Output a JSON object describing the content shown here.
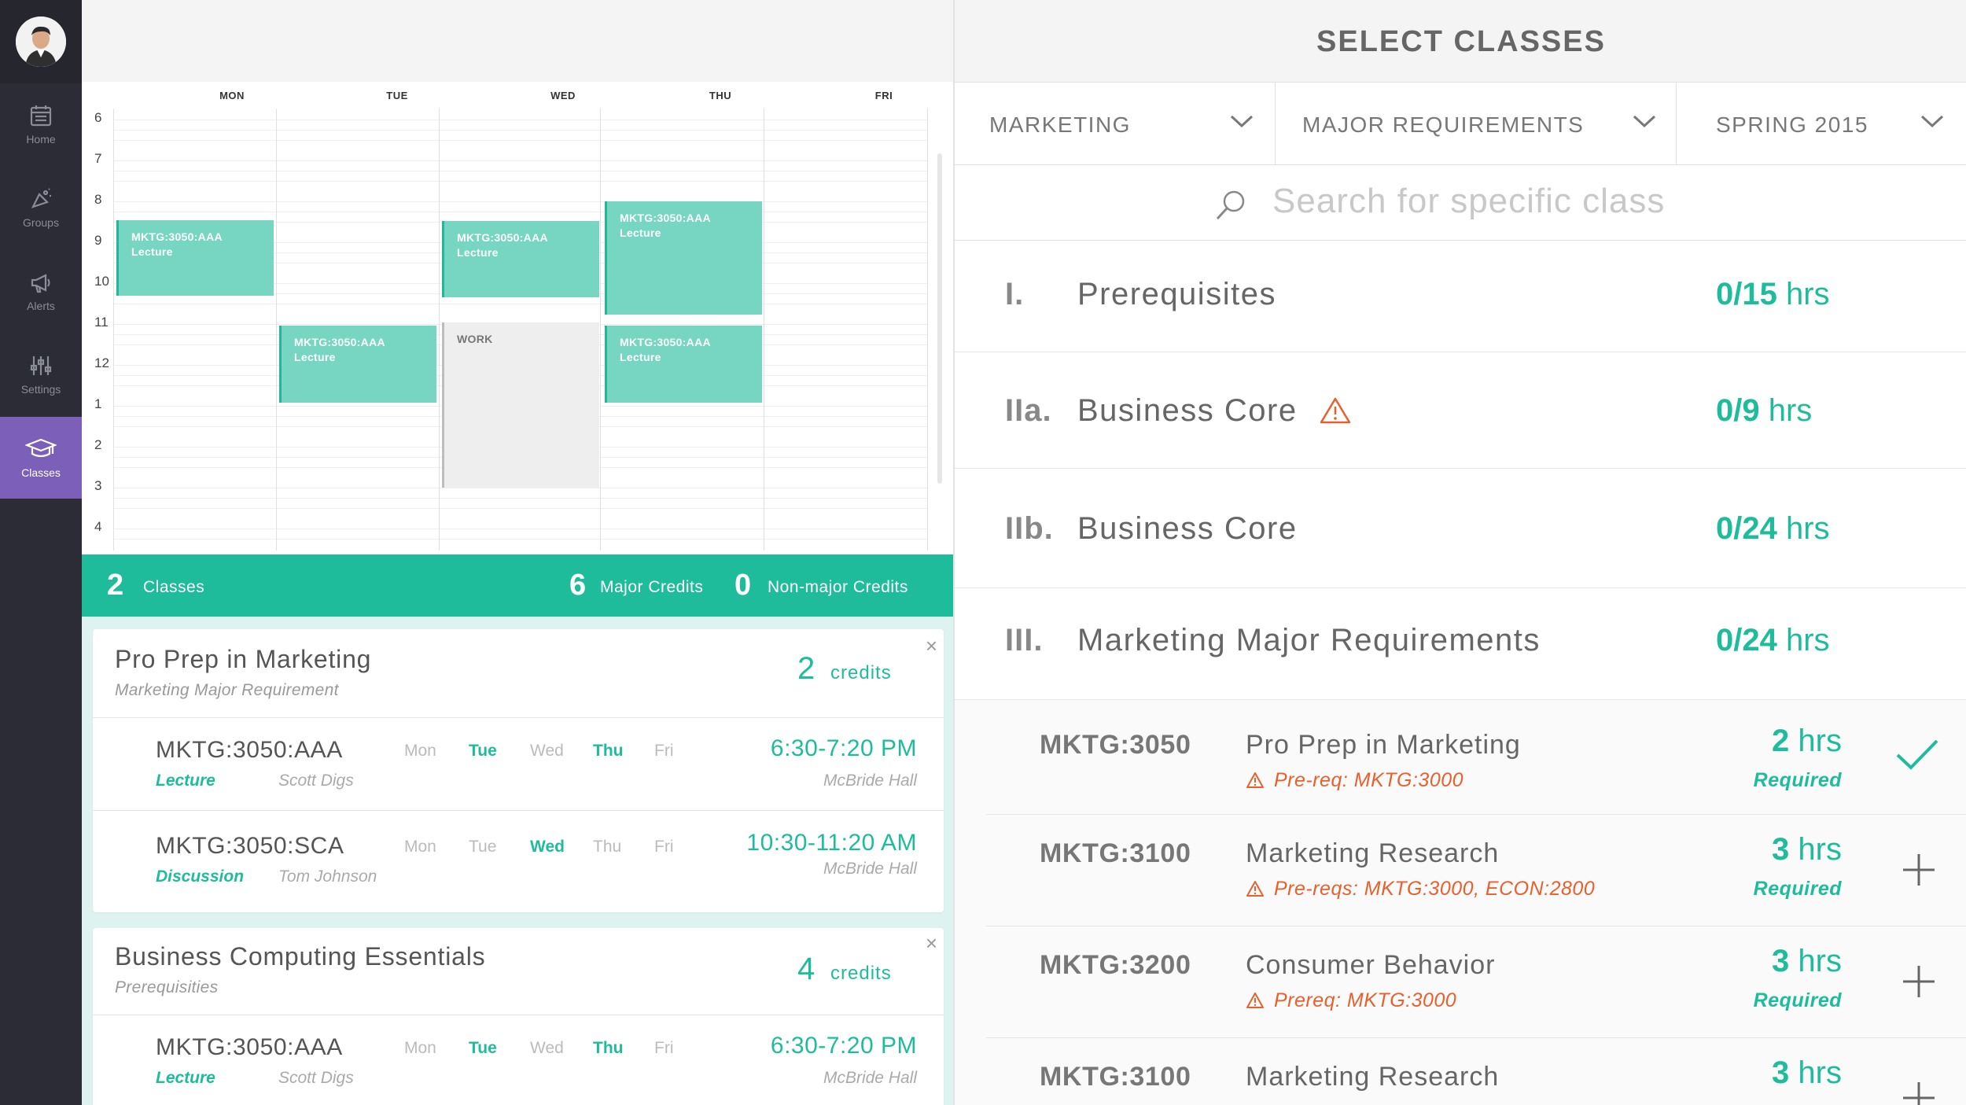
{
  "sidebar": {
    "items": [
      {
        "label": "Home",
        "icon": "calendar-icon"
      },
      {
        "label": "Groups",
        "icon": "groups-icon"
      },
      {
        "label": "Alerts",
        "icon": "megaphone-icon"
      },
      {
        "label": "Settings",
        "icon": "sliders-icon"
      },
      {
        "label": "Classes",
        "icon": "graduation-cap-icon",
        "active": true
      }
    ]
  },
  "calendar": {
    "days": [
      "MON",
      "TUE",
      "WED",
      "THU",
      "FRI"
    ],
    "hours": [
      "6",
      "7",
      "8",
      "9",
      "10",
      "11",
      "12",
      "1",
      "2",
      "3",
      "4"
    ],
    "events": [
      {
        "code": "MKTG:3050:AAA",
        "type": "Lecture"
      },
      {
        "code": "MKTG:3050:AAA",
        "type": "Lecture"
      },
      {
        "code": "MKTG:3050:AAA",
        "type": "Lecture"
      },
      {
        "code": "MKTG:3050:AAA",
        "type": "Lecture"
      },
      {
        "code": "MKTG:3050:AAA",
        "type": "Lecture"
      }
    ],
    "work_block": "WORK"
  },
  "totals": {
    "classes_num": "2",
    "classes_label": "Classes",
    "major_num": "6",
    "major_label": "Major Credits",
    "nonmajor_num": "0",
    "nonmajor_label": "Non-major Credits"
  },
  "cart": [
    {
      "title": "Pro Prep in Marketing",
      "subtitle": "Marketing Major Requirement",
      "credits_num": "2",
      "credits_label": "credits",
      "sections": [
        {
          "code": "MKTG:3050:AAA",
          "type": "Lecture",
          "instructor": "Scott Digs",
          "days": [
            "Mon",
            "Tue",
            "Wed",
            "Thu",
            "Fri"
          ],
          "active_days": [
            false,
            true,
            false,
            true,
            false
          ],
          "time": "6:30-7:20 PM",
          "room": "McBride Hall"
        },
        {
          "code": "MKTG:3050:SCA",
          "type": "Discussion",
          "instructor": "Tom Johnson",
          "days": [
            "Mon",
            "Tue",
            "Wed",
            "Thu",
            "Fri"
          ],
          "active_days": [
            false,
            false,
            true,
            false,
            false
          ],
          "time": "10:30-11:20 AM",
          "room": "McBride Hall"
        }
      ]
    },
    {
      "title": "Business Computing Essentials",
      "subtitle": "Prerequisities",
      "credits_num": "4",
      "credits_label": "credits",
      "sections": [
        {
          "code": "MKTG:3050:AAA",
          "type": "Lecture",
          "instructor": "Scott Digs",
          "days": [
            "Mon",
            "Tue",
            "Wed",
            "Thu",
            "Fri"
          ],
          "active_days": [
            false,
            true,
            false,
            true,
            false
          ],
          "time": "6:30-7:20 PM",
          "room": "McBride Hall"
        }
      ]
    }
  ],
  "right": {
    "title": "SELECT CLASSES",
    "filters": [
      "MARKETING",
      "MAJOR REQUIREMENTS",
      "SPRING 2015"
    ],
    "search_placeholder": "Search for specific class",
    "requirements": [
      {
        "num": "I.",
        "name": "Prerequisites",
        "hrs": "0/15",
        "unit": "hrs",
        "warning": false
      },
      {
        "num": "IIa.",
        "name": "Business Core",
        "hrs": "0/9",
        "unit": "hrs",
        "warning": true
      },
      {
        "num": "IIb.",
        "name": "Business Core",
        "hrs": "0/24",
        "unit": "hrs",
        "warning": false
      },
      {
        "num": "III.",
        "name": "Marketing Major Requirements",
        "hrs": "0/24",
        "unit": "hrs",
        "warning": false
      }
    ],
    "courses": [
      {
        "code": "MKTG:3050",
        "name": "Pro Prep in Marketing",
        "prereq": "Pre-req: MKTG:3000",
        "hrs_num": "2",
        "hrs_unit": "hrs",
        "status": "Required",
        "action": "check"
      },
      {
        "code": "MKTG:3100",
        "name": "Marketing Research",
        "prereq": "Pre-reqs: MKTG:3000, ECON:2800",
        "hrs_num": "3",
        "hrs_unit": "hrs",
        "status": "Required",
        "action": "add"
      },
      {
        "code": "MKTG:3200",
        "name": "Consumer Behavior",
        "prereq": "Prereq: MKTG:3000",
        "hrs_num": "3",
        "hrs_unit": "hrs",
        "status": "Required",
        "action": "add"
      },
      {
        "code": "MKTG:3100",
        "name": "Marketing Research",
        "prereq": "",
        "hrs_num": "3",
        "hrs_unit": "hrs",
        "status": "",
        "action": "add"
      }
    ]
  },
  "colors": {
    "accent": "#1fbc9c",
    "sidebar": "#2b2c35",
    "active_nav": "#7b5fb8",
    "warning": "#e8602c"
  }
}
